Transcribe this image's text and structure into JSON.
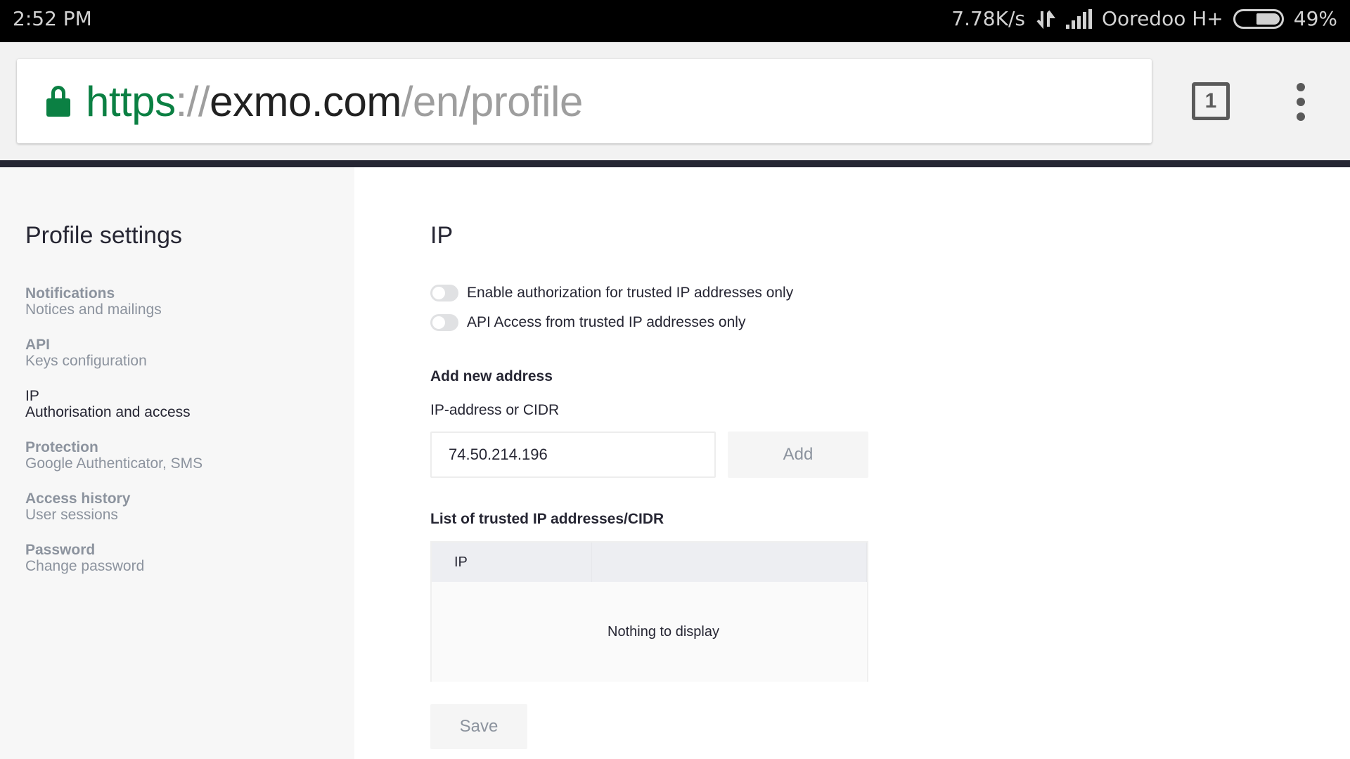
{
  "status_bar": {
    "time": "2:52 PM",
    "network_speed": "7.78K/s",
    "carrier": "Ooredoo H+",
    "battery_percent": "49%",
    "battery_level": 0.49,
    "icons": [
      "data-transfer-arrows-icon",
      "signal-strength-icon",
      "battery-icon"
    ]
  },
  "browser": {
    "url": {
      "scheme": "https",
      "separator": "://",
      "host": "exmo.com",
      "path": "/en/profile"
    },
    "tab_count": "1",
    "icons": [
      "lock-icon",
      "tabs-icon",
      "overflow-menu-icon"
    ],
    "secure_color": "#0b8043"
  },
  "sidebar": {
    "title": "Profile settings",
    "items": [
      {
        "label": "Notifications",
        "sublabel": "Notices and mailings",
        "active": false
      },
      {
        "label": "API",
        "sublabel": "Keys configuration",
        "active": false
      },
      {
        "label": "IP",
        "sublabel": "Authorisation and access",
        "active": true
      },
      {
        "label": "Protection",
        "sublabel": "Google Authenticator, SMS",
        "active": false
      },
      {
        "label": "Access history",
        "sublabel": "User sessions",
        "active": false
      },
      {
        "label": "Password",
        "sublabel": "Change password",
        "active": false
      }
    ]
  },
  "main": {
    "title": "IP",
    "toggles": [
      {
        "label": "Enable authorization for trusted IP addresses only",
        "enabled": false
      },
      {
        "label": "API Access from trusted IP addresses only",
        "enabled": false
      }
    ],
    "add_section": {
      "title": "Add new address",
      "field_label": "IP-address or CIDR",
      "field_value": "74.50.214.196",
      "add_button": "Add"
    },
    "list_section": {
      "title": "List of trusted IP addresses/CIDR",
      "columns": [
        "IP",
        ""
      ],
      "rows": [],
      "empty_text": "Nothing to display"
    },
    "save_button": "Save"
  }
}
